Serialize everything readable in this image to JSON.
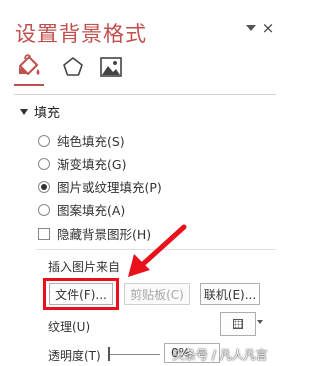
{
  "header": {
    "title": "设置背景格式",
    "dropdown_icon": "chevron-down-icon",
    "close_label": "×"
  },
  "tabs": [
    {
      "name": "fill-bucket-icon",
      "selected": true
    },
    {
      "name": "pentagon-icon",
      "selected": false
    },
    {
      "name": "picture-icon",
      "selected": false
    }
  ],
  "section": {
    "label": "填充",
    "expanded": true
  },
  "fill_options": [
    {
      "label": "纯色填充(S)",
      "type": "radio",
      "checked": false
    },
    {
      "label": "渐变填充(G)",
      "type": "radio",
      "checked": false
    },
    {
      "label": "图片或纹理填充(P)",
      "type": "radio",
      "checked": true
    },
    {
      "label": "图案填充(A)",
      "type": "radio",
      "checked": false
    },
    {
      "label": "隐藏背景图形(H)",
      "type": "checkbox",
      "checked": false
    }
  ],
  "insert": {
    "label": "插入图片来自",
    "file_button": "文件(F)...",
    "clipboard_button": "剪贴板(C)",
    "online_button": "联机(E)..."
  },
  "texture": {
    "label": "纹理(U)"
  },
  "transparency": {
    "label": "透明度(T)",
    "value": "0%"
  },
  "watermark": "头条号 / 凡人凡言",
  "colors": {
    "accent": "#c0504d",
    "highlight": "#e8101a"
  }
}
